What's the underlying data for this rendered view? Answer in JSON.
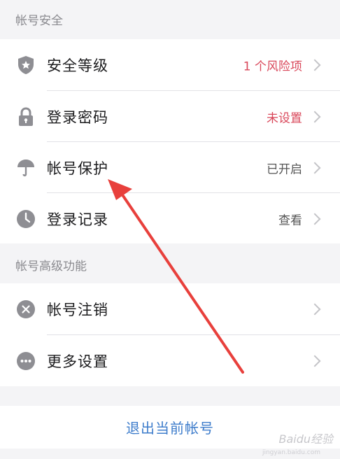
{
  "sections": {
    "account_security": "帐号安全",
    "account_advanced": "帐号高级功能"
  },
  "security_items": [
    {
      "label": "安全等级",
      "value": "1 个风险项",
      "icon": "shield-star-icon",
      "value_color": "#d9475a"
    },
    {
      "label": "登录密码",
      "value": "未设置",
      "icon": "lock-icon",
      "value_color": "#d9475a"
    },
    {
      "label": "帐号保护",
      "value": "已开启",
      "icon": "umbrella-icon",
      "value_color": "#555555"
    },
    {
      "label": "登录记录",
      "value": "查看",
      "icon": "clock-icon",
      "value_color": "#555555"
    }
  ],
  "advanced_items": [
    {
      "label": "帐号注销",
      "icon": "close-circle-icon"
    },
    {
      "label": "更多设置",
      "icon": "more-dots-icon"
    }
  ],
  "logout": {
    "label": "退出当前帐号",
    "color": "#3d7ccb"
  },
  "annotation": {
    "arrow_color": "#e8403c"
  },
  "watermark": {
    "text": "Baidu经验",
    "url": "jingyan.baidu.com"
  }
}
